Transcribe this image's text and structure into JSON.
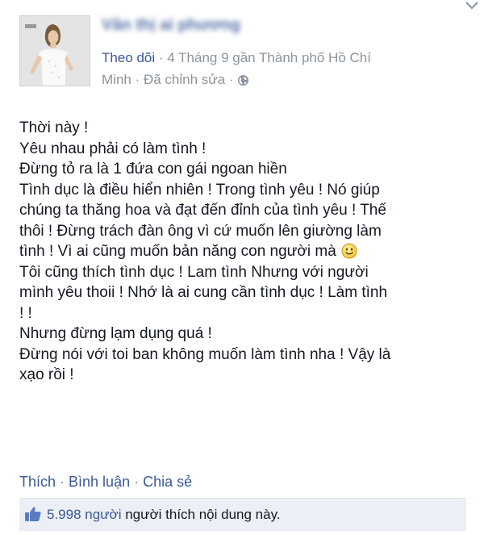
{
  "post": {
    "author": "Văn thị ai phương",
    "follow": "Theo dõi",
    "meta_line1": " · 4 Tháng 9 gần Thành phố Hồ Chí",
    "meta_line2": "Minh · Đã chỉnh sửa ·",
    "privacy_icon": "globe-icon",
    "message_lines": [
      "Thời này !",
      "Yêu nhau phải có làm tình !",
      "Đừng tỏ ra là 1 đứa con gái ngoan hiền",
      "Tình dục là điều hiển nhiên ! Trong tình yêu ! Nó giúp",
      "chúng ta thăng hoa và đạt đến đỉnh của tình yêu ! Thế",
      "thôi ! Đừng trách đàn ông vì cứ muốn lên giường làm",
      "tình ! Vì ai cũng muốn bản năng con người mà",
      "Tôi cũng thích tình dục ! Lam tình Nhưng với người",
      "mình yêu thoii ! Nhớ là ai cung cần tình dục ! Làm tình",
      "! !",
      "Nhưng đừng lạm dụng quá !",
      "Đừng nói với toi ban không muốn làm tình nha ! Vậy là",
      "xạo rồi !"
    ],
    "emoticon": "smiley-icon"
  },
  "actions": {
    "like": "Thích",
    "comment": "Bình luận",
    "share": "Chia sẻ",
    "separator": " · "
  },
  "likes": {
    "count": "5.998 người",
    "text": " người thích nội dung này."
  },
  "colors": {
    "link": "#3b5998",
    "meta": "#8d949e",
    "text": "#141823",
    "likes_bar": "#eceff5"
  }
}
